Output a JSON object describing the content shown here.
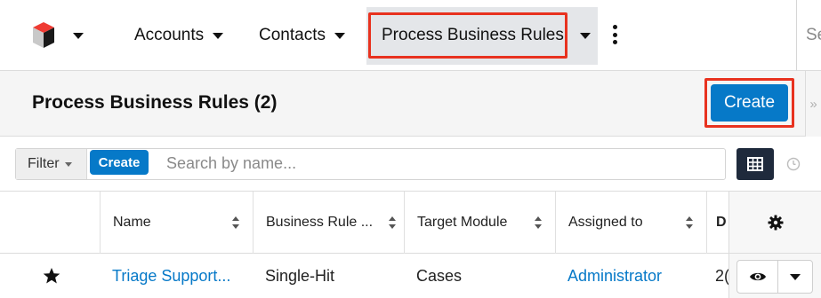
{
  "nav": {
    "items": [
      {
        "label": "Accounts"
      },
      {
        "label": "Contacts"
      },
      {
        "label": "Process Business Rules"
      }
    ],
    "search_hint": "Se"
  },
  "header": {
    "title": "Process Business Rules (2)",
    "create_label": "Create"
  },
  "filter": {
    "dropdown_label": "Filter",
    "create_label": "Create",
    "search_placeholder": "Search by name..."
  },
  "table": {
    "columns": [
      {
        "label": "Name"
      },
      {
        "label": "Business Rule ..."
      },
      {
        "label": "Target Module"
      },
      {
        "label": "Assigned to"
      },
      {
        "label": "D"
      }
    ],
    "rows": [
      {
        "favorite": true,
        "name": "Triage Support...",
        "business_rule_type": "Single-Hit",
        "target_module": "Cases",
        "assigned_to": "Administrator",
        "date_partial": "2("
      }
    ]
  },
  "colors": {
    "accent": "#0679c8",
    "highlight": "#e8321f",
    "nav_active_bg": "#e4e6e9"
  }
}
